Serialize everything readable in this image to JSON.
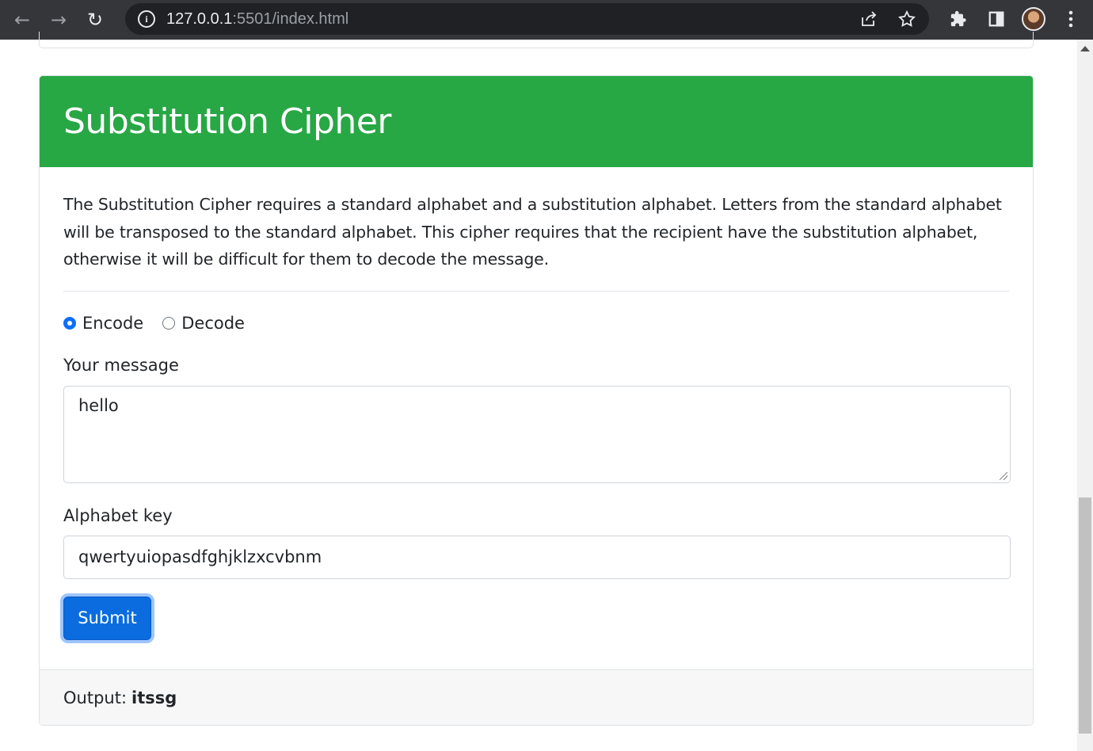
{
  "browser": {
    "url_host": "127.0.0.1",
    "url_rest": ":5501/index.html",
    "back_icon": "←",
    "forward_icon": "→",
    "reload_icon": "↻"
  },
  "card": {
    "title": "Substitution Cipher",
    "description": "The Substitution Cipher requires a standard alphabet and a substitution alphabet. Letters from the standard alphabet will be transposed to the standard alphabet. This cipher requires that the recipient have the substitution alphabet, otherwise it will be difficult for them to decode the message."
  },
  "form": {
    "mode_options": [
      {
        "label": "Encode",
        "checked": true
      },
      {
        "label": "Decode",
        "checked": false
      }
    ],
    "message_label": "Your message",
    "message_value": "hello",
    "key_label": "Alphabet key",
    "key_value": "qwertyuiopasdfghjklzxcvbnm",
    "submit_label": "Submit"
  },
  "output": {
    "label": "Output:",
    "value": "itssg"
  },
  "colors": {
    "header_green": "#28a745",
    "primary_blue": "#0a6cdf"
  }
}
